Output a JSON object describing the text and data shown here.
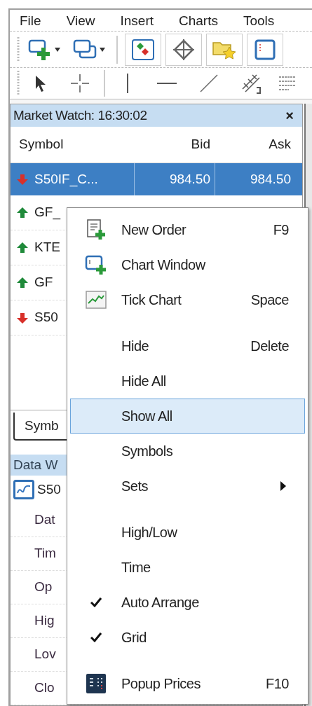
{
  "menu_bar": [
    {
      "label": "File"
    },
    {
      "label": "View"
    },
    {
      "label": "Insert"
    },
    {
      "label": "Charts"
    },
    {
      "label": "Tools"
    }
  ],
  "market_watch": {
    "title": "Market Watch: 16:30:02",
    "close": "×",
    "columns": [
      "Symbol",
      "Bid",
      "Ask"
    ],
    "rows": [
      {
        "symbol": "S50IF_C...",
        "rising": false,
        "bid": "984.50",
        "ask": "984.50",
        "selected": true
      },
      {
        "symbol": "GF_",
        "rising": true,
        "selected": false
      },
      {
        "symbol": "KTE",
        "rising": true,
        "selected": false
      },
      {
        "symbol": "GF",
        "rising": true,
        "selected": false
      },
      {
        "symbol": "S50",
        "rising": false,
        "selected": false
      }
    ],
    "tabs": [
      {
        "label": "Symb",
        "selected": true
      }
    ]
  },
  "data_window": {
    "title": "Data W",
    "symbol": "S50",
    "rows": [
      "Dat",
      "Tim",
      "Op",
      "Hig",
      "Lov",
      "Clo"
    ]
  },
  "context_menu": [
    {
      "kind": "item",
      "label": "New Order",
      "shortcut": "F9",
      "checked": false,
      "selected": false
    },
    {
      "kind": "item",
      "label": "Chart Window",
      "checked": false,
      "selected": false
    },
    {
      "kind": "item",
      "label": "Tick Chart",
      "shortcut": "Space",
      "checked": false,
      "selected": false
    },
    {
      "kind": "separator"
    },
    {
      "kind": "item",
      "label": "Hide",
      "shortcut": "Delete",
      "checked": false,
      "selected": false
    },
    {
      "kind": "item",
      "label": "Hide All",
      "checked": false,
      "selected": false
    },
    {
      "kind": "item",
      "label": "Show All",
      "checked": false,
      "selected": true
    },
    {
      "kind": "item",
      "label": "Symbols",
      "checked": false,
      "selected": false
    },
    {
      "kind": "submenu",
      "label": "Sets",
      "checked": false,
      "selected": false
    },
    {
      "kind": "separator"
    },
    {
      "kind": "item",
      "label": "High/Low",
      "checked": false,
      "selected": false
    },
    {
      "kind": "item",
      "label": "Time",
      "checked": false,
      "selected": false
    },
    {
      "kind": "item",
      "label": "Auto Arrange",
      "checked": true,
      "selected": false
    },
    {
      "kind": "item",
      "label": "Grid",
      "checked": true,
      "selected": false
    },
    {
      "kind": "separator"
    },
    {
      "kind": "item",
      "label": "Popup Prices",
      "shortcut": "F10",
      "checked": false,
      "selected": false
    }
  ]
}
